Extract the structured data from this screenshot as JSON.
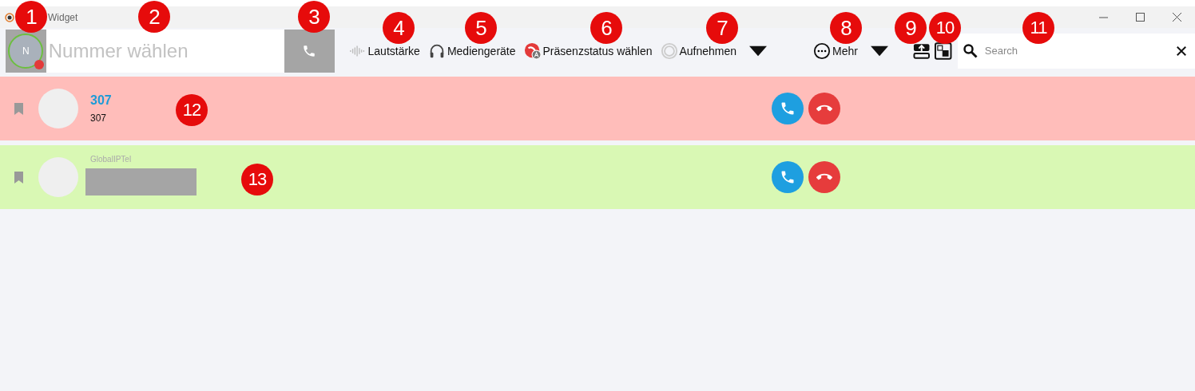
{
  "window": {
    "title": "Widget"
  },
  "toolbar": {
    "avatar": {
      "initial": "N",
      "status": {
        "color": "#e33a3a"
      }
    },
    "dial_field": {
      "placeholder": "Nummer wählen"
    },
    "items": [
      {
        "kind": "volume",
        "label": "Lautstärke"
      },
      {
        "kind": "headset",
        "label": "Mediengeräte"
      },
      {
        "kind": "presence",
        "label": "Präsenzstatus wählen"
      },
      {
        "kind": "record",
        "label": "Aufnehmen",
        "dropdown": true
      },
      {
        "kind": "more",
        "label": "Mehr",
        "dropdown": true
      }
    ],
    "search": {
      "placeholder": "Search"
    }
  },
  "calls": [
    {
      "color": "#ffbdba",
      "title": "307",
      "subtitle": "307"
    },
    {
      "color": "#d9f8b4",
      "caption": "GlobalIPTel",
      "redacted": true
    }
  ],
  "callouts": [
    "1",
    "2",
    "3",
    "4",
    "5",
    "6",
    "7",
    "8",
    "9",
    "10",
    "11",
    "12",
    "13"
  ]
}
